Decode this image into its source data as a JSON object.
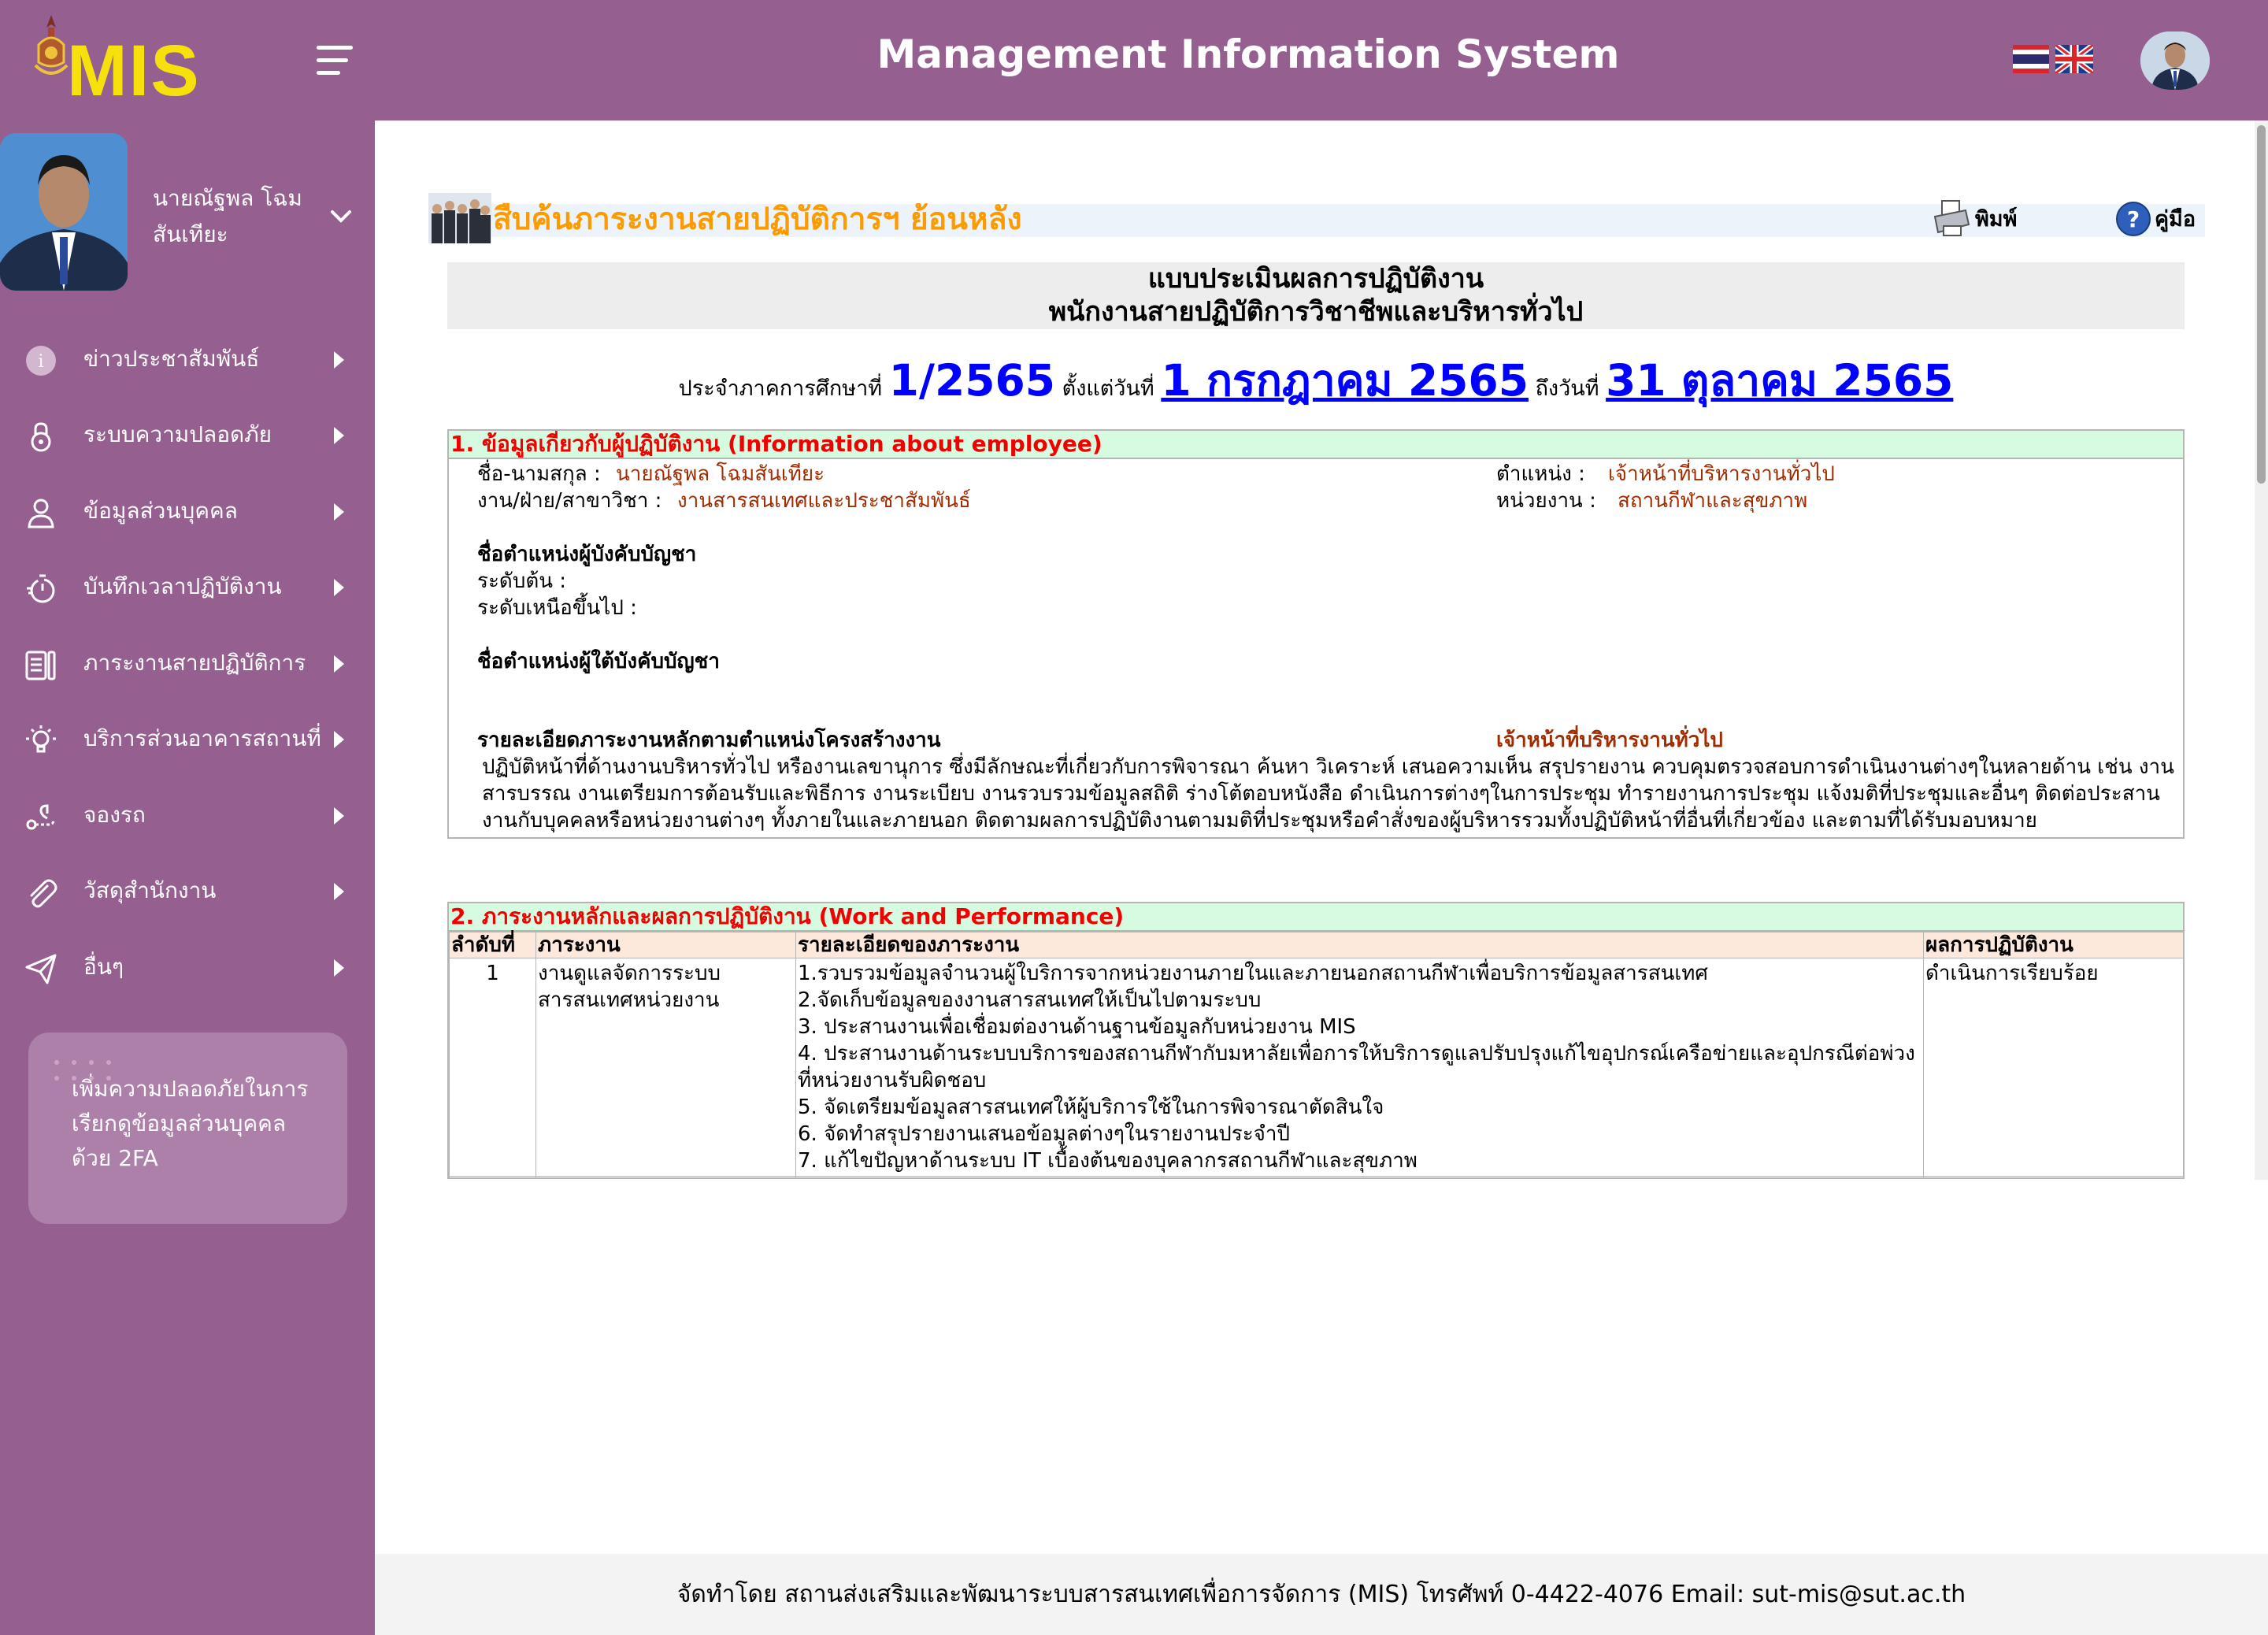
{
  "header": {
    "logo_text": "MIS",
    "app_title": "Management Information System"
  },
  "profile": {
    "name": "นายณัฐพล โฉมสันเทียะ"
  },
  "sidebar": {
    "items": [
      {
        "label": "ข่าวประชาสัมพันธ์",
        "icon": "info-icon"
      },
      {
        "label": "ระบบความปลอดภัย",
        "icon": "lock-icon"
      },
      {
        "label": "ข้อมูลส่วนบุคคล",
        "icon": "user-icon"
      },
      {
        "label": "บันทึกเวลาปฏิบัติงาน",
        "icon": "stopwatch-icon"
      },
      {
        "label": "ภาระงานสายปฏิบัติการ",
        "icon": "clipboard-icon"
      },
      {
        "label": "บริการส่วนอาคารสถานที่",
        "icon": "lightbulb-icon"
      },
      {
        "label": "จองรถ",
        "icon": "route-icon"
      },
      {
        "label": "วัสดุสำนักงาน",
        "icon": "paperclip-icon"
      },
      {
        "label": "อื่นๆ",
        "icon": "send-icon"
      }
    ],
    "twofa_text": "เพิ่มความปลอดภัยในการเรียกดูข้อมูลส่วนบุคคล ด้วย 2FA"
  },
  "report": {
    "title": "สืบค้นภาระงานสายปฏิบัติการฯ ย้อนหลัง",
    "print_label": "พิมพ์",
    "manual_label": "คู่มือ",
    "form_title_1": "แบบประเมินผลการปฏิบัติงาน",
    "form_title_2": "พนักงานสายปฏิบัติการวิชาชีพและบริหารทั่วไป",
    "period_prefix": "ประจำภาคการศึกษาที่",
    "semester": "1/2565",
    "from_label": "ตั้งแต่วันที่",
    "from_date": "1 กรกฎาคม 2565",
    "to_label": "ถึงวันที่",
    "to_date": "31 ตุลาคม 2565"
  },
  "section1": {
    "heading": "1. ข้อมูลเกี่ยวกับผู้ปฏิบัติงาน (Information about employee)",
    "name_label": "ชื่อ-นามสกุล :",
    "name_value": "นายณัฐพล โฉมสันเทียะ",
    "unit_label": "งาน/ฝ่าย/สาขาวิชา :",
    "unit_value": "งานสารสนเทศและประชาสัมพันธ์",
    "position_label": "ตำแหน่ง :",
    "position_value": "เจ้าหน้าที่บริหารงานทั่วไป",
    "dept_label": "หน่วยงาน :",
    "dept_value": "สถานกีฬาและสุขภาพ",
    "supervisor_heading": "ชื่อตำแหน่งผู้บังคับบัญชา",
    "level1_label": "ระดับต้น :",
    "level2_label": "ระดับเหนือขึ้นไป :",
    "subordinate_heading": "ชื่อตำแหน่งผู้ใต้บังคับบัญชา",
    "duty_heading": "รายละเอียดภาระงานหลักตามตำแหน่งโครงสร้างงาน",
    "duty_position": "เจ้าหน้าที่บริหารงานทั่วไป",
    "duty_text": "ปฏิบัติหน้าที่ด้านงานบริหารทั่วไป หรืองานเลขานุการ ซึ่งมีลักษณะที่เกี่ยวกับการพิจารณา ค้นหา วิเคราะห์ เสนอความเห็น สรุปรายงาน ควบคุมตรวจสอบการดำเนินงานต่างๆในหลายด้าน เช่น งานสารบรรณ งานเตรียมการต้อนรับและพิธีการ งานระเบียบ งานรวบรวมข้อมูลสถิติ ร่างโต้ตอบหนังสือ ดำเนินการต่างๆในการประชุม ทำรายงานการประชุม แจ้งมติที่ประชุมและอื่นๆ ติดต่อประสานงานกับบุคคลหรือหน่วยงานต่างๆ ทั้งภายในและภายนอก ติดตามผลการปฏิบัติงานตามมติที่ประชุมหรือคำสั่งของผู้บริหารรวมทั้งปฏิบัติหน้าที่อื่นที่เกี่ยวข้อง และตามที่ได้รับมอบหมาย"
  },
  "section2": {
    "heading": "2. ภาระงานหลักและผลการปฏิบัติงาน (Work and Performance)",
    "columns": [
      "ลำดับที่",
      "ภาระงาน",
      "รายละเอียดของภาระงาน",
      "ผลการปฏิบัติงาน"
    ],
    "rows": [
      {
        "no": "1",
        "task": "งานดูแลจัดการระบบสารสนเทศหน่วยงาน",
        "details": "1.รวบรวมข้อมูลจำนวนผู้ใบริการจากหน่วยงานภายในและภายนอกสถานกีฬาเพื่อบริการข้อมูลสารสนเทศ\n2.จัดเก็บข้อมูลของงานสารสนเทศให้เป็นไปตามระบบ\n3. ประสานงานเพื่อเชื่อมต่องานด้านฐานข้อมูลกับหน่วยงาน MIS\n4. ประสานงานด้านระบบบริการของสถานกีฬากับมหาลัยเพื่อการให้บริการดูแลปรับปรุงแก้ไขอุปกรณ์เครือข่ายและอุปกรณีต่อพ่วงที่หน่วยงานรับผิดชอบ\n5. จัดเตรียมข้อมูลสารสนเทศให้ผู้บริการใช้ในการพิจารณาตัดสินใจ\n6. จัดทำสรุปรายงานเสนอข้อมูลต่างๆในรายงานประจำปี\n7. แก้ไขปัญหาด้านระบบ IT เบื้องต้นของบุคลากรสถานกีฬาและสุขภาพ",
        "result": "ดำเนินการเรียบร้อย"
      }
    ]
  },
  "footer": {
    "text": "จัดทำโดย สถานส่งเสริมและพัฒนาระบบสารสนเทศเพื่อการจัดการ (MIS) โทรศัพท์ 0-4422-4076 Email: sut-mis@sut.ac.th"
  },
  "colors": {
    "brand_purple": "#956090",
    "logo_yellow": "#f7e10d",
    "title_orange": "#fb9b00",
    "heading_red": "#f10000",
    "value_brown": "#a02c00",
    "link_blue": "#0000ff"
  }
}
